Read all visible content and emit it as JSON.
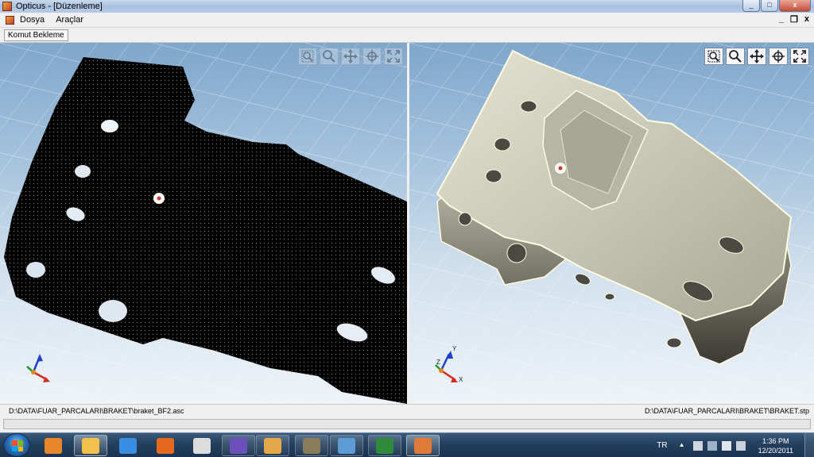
{
  "window": {
    "title": "Opticus - [Düzenleme]",
    "controls": [
      "_",
      "□",
      "x"
    ]
  },
  "menu": {
    "items": [
      "Dosya",
      "Araçlar"
    ],
    "mdi_controls": [
      "_",
      "❐",
      "x"
    ]
  },
  "command_bar": {
    "status": "Komut Bekleme"
  },
  "viewports": {
    "left": {
      "tools": [
        "zoom-window-icon",
        "zoom-icon",
        "pan-icon",
        "rotate-icon",
        "fit-all-icon"
      ],
      "tools_state": "disabled",
      "axis": {
        "z": "",
        "y": "",
        "x": ""
      }
    },
    "right": {
      "tools": [
        "zoom-window-icon",
        "zoom-icon",
        "pan-icon",
        "rotate-icon",
        "fit-all-icon"
      ],
      "tools_state": "enabled",
      "axis": {
        "z": "Z",
        "y": "Y",
        "x": "X"
      }
    }
  },
  "status": {
    "left_path": "D:\\DATA\\FUAR_PARCALARI\\BRAKET\\braket_BF2.asc",
    "right_path": "D:\\DATA\\FUAR_PARCALARI\\BRAKET\\BRAKET.stp"
  },
  "taskbar": {
    "apps": [
      {
        "name": "media-player",
        "color": "#e8862c",
        "state": "pinned"
      },
      {
        "name": "explorer",
        "color": "#f2c04d",
        "state": "active"
      },
      {
        "name": "internet-explorer",
        "color": "#3a8de0",
        "state": "pinned"
      },
      {
        "name": "firefox",
        "color": "#e56a1f",
        "state": "pinned"
      },
      {
        "name": "calendar",
        "color": "#dcdcdc",
        "state": "pinned"
      },
      {
        "name": "visual-studio",
        "color": "#6b4fbb",
        "state": "open"
      },
      {
        "name": "paint",
        "color": "#e2a84a",
        "state": "open"
      },
      {
        "name": "gimp",
        "color": "#8a7b5a",
        "state": "open"
      },
      {
        "name": "window-app",
        "color": "#5c9bd6",
        "state": "open"
      },
      {
        "name": "excel",
        "color": "#2f8a3c",
        "state": "open"
      },
      {
        "name": "opticus",
        "color": "#e07a38",
        "state": "active"
      }
    ],
    "language": "TR",
    "time": "1:36 PM",
    "date": "12/20/2011"
  },
  "colors": {
    "accent": "#2a6fb8",
    "part_fill": "#c8c6b4",
    "point_cloud": "#000000"
  }
}
